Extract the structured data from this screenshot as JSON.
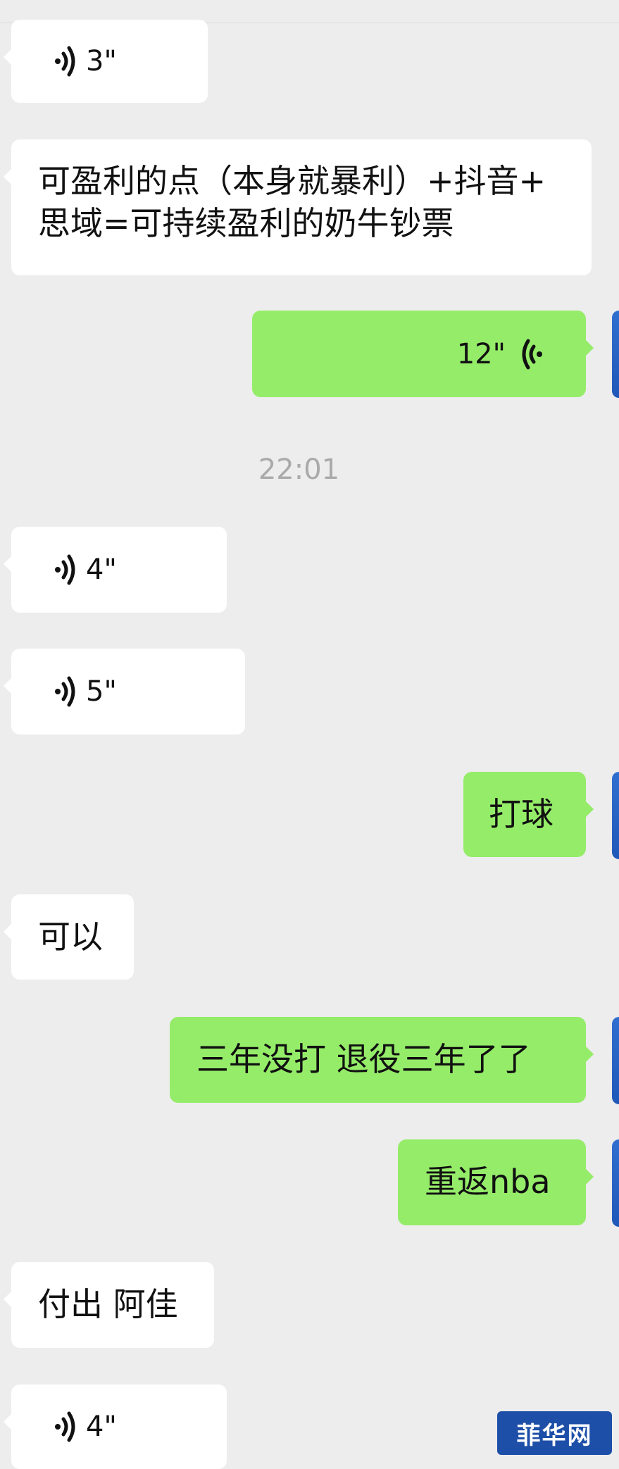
{
  "messages": [
    {
      "side": "in",
      "type": "voice",
      "duration": "3\""
    },
    {
      "side": "in",
      "type": "text",
      "lines": [
        "可盈利的点（本身就暴利）+抖音+",
        "思域=可持续盈利的奶牛钞票"
      ]
    },
    {
      "side": "out",
      "type": "voice",
      "duration": "12\""
    },
    {
      "type": "time",
      "text": "22:01"
    },
    {
      "side": "in",
      "type": "voice",
      "duration": "4\""
    },
    {
      "side": "in",
      "type": "voice",
      "duration": "5\""
    },
    {
      "side": "out",
      "type": "text",
      "text": "打球"
    },
    {
      "side": "in",
      "type": "text",
      "text": "可以"
    },
    {
      "side": "out",
      "type": "text",
      "text": "三年没打 退役三年了了"
    },
    {
      "side": "out",
      "type": "text",
      "text": "重返nba"
    },
    {
      "side": "in",
      "type": "text",
      "text": "付出 阿佳"
    },
    {
      "side": "in",
      "type": "voice",
      "duration": "4\""
    }
  ],
  "watermark": "菲华网",
  "colors": {
    "background": "#ededed",
    "incoming": "#ffffff",
    "outgoing": "#95ec69",
    "timestamp": "#aaaaaa"
  },
  "icons": {
    "voice": "voice-wave-icon"
  }
}
